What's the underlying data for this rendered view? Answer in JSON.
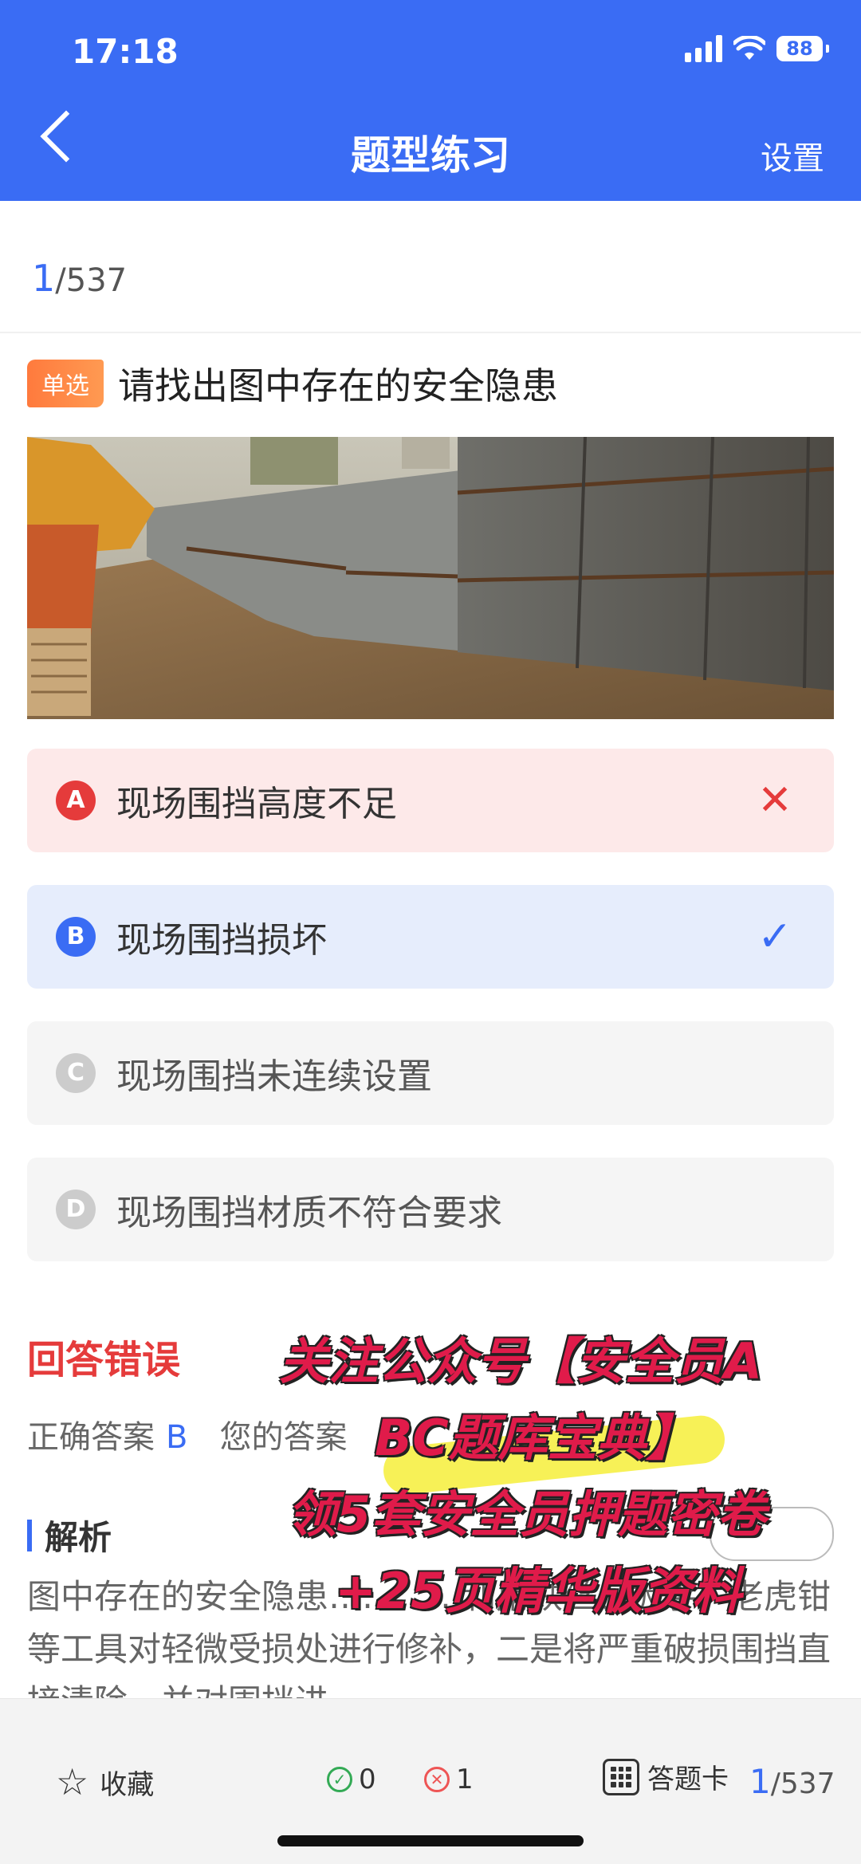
{
  "status_bar": {
    "time": "17:18",
    "battery": "88"
  },
  "header": {
    "title": "题型练习",
    "settings_label": "设置"
  },
  "progress": {
    "current": "1",
    "total": "/537"
  },
  "question": {
    "type_badge": "单选",
    "text": "请找出图中存在的安全隐患"
  },
  "options": [
    {
      "letter": "A",
      "text": "现场围挡高度不足",
      "state": "wrong",
      "mark": "✕",
      "color": "#e53b3b"
    },
    {
      "letter": "B",
      "text": "现场围挡损坏",
      "state": "correct",
      "mark": "✓",
      "color": "#3a6cf4"
    },
    {
      "letter": "C",
      "text": "现场围挡未连续设置",
      "state": "normal",
      "mark": "",
      "color": "#cccccc"
    },
    {
      "letter": "D",
      "text": "现场围挡材质不符合要求",
      "state": "normal",
      "mark": "",
      "color": "#cccccc"
    }
  ],
  "result": {
    "status": "回答错误",
    "correct_label": "正确答案",
    "correct_value": "B",
    "yours_label": "您的答案"
  },
  "analysis": {
    "title": "解析",
    "text": "图中存在的安全隐患…………利用铁丝、扳手、老虎钳等工具对轻微受损处进行修补，二是将严重破损围挡直接清除，并对围挡进"
  },
  "promo": {
    "line1": "关注公众号【安全员A",
    "line2": "BC题库宝典】",
    "line3": "领5套安全员押题密卷",
    "line4": "+25页精华版资料"
  },
  "bottom_bar": {
    "favorite_label": "收藏",
    "correct_count": "0",
    "wrong_count": "1",
    "answer_card_label": "答题卡",
    "progress_current": "1",
    "progress_total": "/537"
  },
  "colors": {
    "primary": "#3a6cf4",
    "error": "#e53b3b",
    "badge": "#ff7a3d"
  }
}
